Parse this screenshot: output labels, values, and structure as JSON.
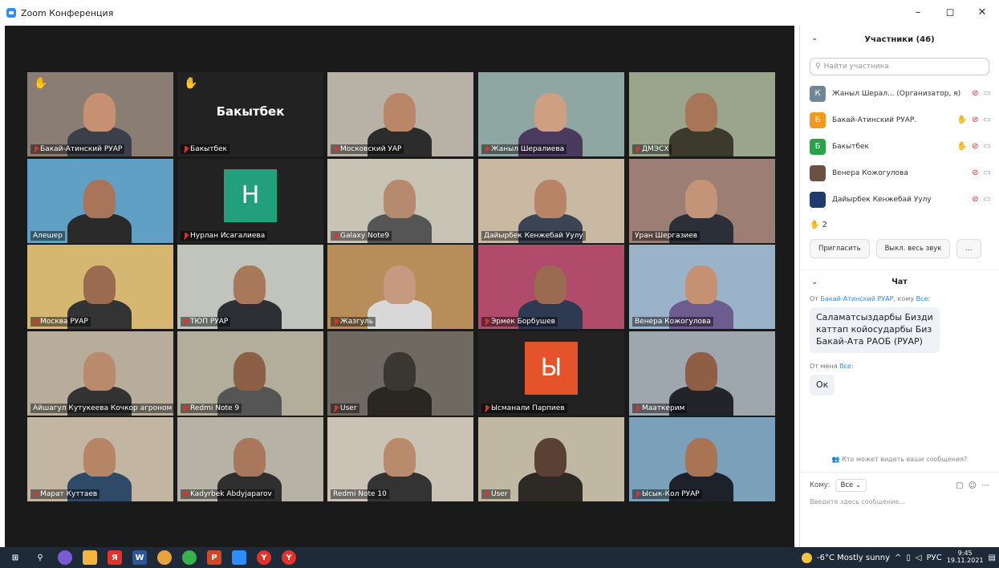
{
  "window": {
    "title": "Zoom Конференция",
    "min": "–",
    "max": "◻",
    "close": "✕"
  },
  "tiles": [
    {
      "name": "Бакай-Атинский РУАР",
      "hand": true,
      "muted": true,
      "kind": "video",
      "bg": "#8a7d74",
      "skin": "#c69072",
      "shirt": "#3b3f4a"
    },
    {
      "name": "Бакытбек",
      "hand": true,
      "muted": true,
      "kind": "text",
      "big": "Бакытбек"
    },
    {
      "name": "Московский УАР",
      "muted": true,
      "kind": "video",
      "bg": "#b8b1a6",
      "skin": "#b98768",
      "shirt": "#2c2c2c"
    },
    {
      "name": "Жаныл Шералиева",
      "muted": true,
      "kind": "video",
      "bg": "#8fa7a3",
      "skin": "#cf9f82",
      "shirt": "#4a3a5e"
    },
    {
      "name": "ДМЭСХ",
      "muted": true,
      "kind": "video",
      "bg": "#9aa58b",
      "skin": "#a87558",
      "shirt": "#3c3a2d"
    },
    {
      "name": "Алешер",
      "kind": "video",
      "bg": "#5fa0c4",
      "skin": "#a8745a",
      "shirt": "#2a2a2a"
    },
    {
      "name": "Нурлан Исагалиева",
      "muted": true,
      "kind": "avatar",
      "letter": "Н",
      "color": "#21a07b"
    },
    {
      "name": "Galaxy Note9",
      "muted": true,
      "kind": "video",
      "bg": "#c7c3b5",
      "skin": "#b58a6e",
      "shirt": "#555"
    },
    {
      "name": "Дайырбек Кенжебай Уулу",
      "kind": "video",
      "active": true,
      "bg": "#c9b9a2",
      "skin": "#b78565",
      "shirt": "#3c4454"
    },
    {
      "name": "Уран Шергазиев",
      "kind": "video",
      "bg": "#9c7e74",
      "skin": "#c49479",
      "shirt": "#2b2f38"
    },
    {
      "name": "Москва РУАР",
      "muted": true,
      "kind": "video",
      "bg": "#d6b771",
      "skin": "#9a6b51",
      "shirt": "#333"
    },
    {
      "name": "ТЮП РУАР",
      "muted": true,
      "kind": "video",
      "bg": "#c0c4bc",
      "skin": "#a9785a",
      "shirt": "#2c2f33"
    },
    {
      "name": "Жазгуль",
      "muted": true,
      "kind": "video",
      "bg": "#b78d5a",
      "skin": "#c59a80",
      "shirt": "#d8d8d8"
    },
    {
      "name": "Эрмек Борбушев",
      "muted": true,
      "kind": "video",
      "bg": "#b04b6b",
      "skin": "#9a6b51",
      "shirt": "#2e3a52"
    },
    {
      "name": "Венера Кожогулова",
      "kind": "video",
      "bg": "#9bb3c9",
      "skin": "#c69172",
      "shirt": "#6d5d8f"
    },
    {
      "name": "Айшагул Кутукеева  Кочкор агроном",
      "kind": "video",
      "bg": "#b8ad9b",
      "skin": "#b98a6c",
      "shirt": "#333"
    },
    {
      "name": "Redmi Note 9",
      "muted": true,
      "kind": "video",
      "bg": "#b3ae9c",
      "skin": "#8c5f47",
      "shirt": "#555"
    },
    {
      "name": "User",
      "muted": true,
      "kind": "video",
      "bg": "#6f6a61",
      "skin": "#3a3631",
      "shirt": "#2a2622"
    },
    {
      "name": "Ысманали Парпиев",
      "muted": true,
      "kind": "avatar",
      "letter": "Ы",
      "color": "#e5532b"
    },
    {
      "name": "Мааткерим",
      "muted": true,
      "kind": "video",
      "bg": "#9ea7ad",
      "skin": "#8e5e45",
      "shirt": "#22242a"
    },
    {
      "name": "Марат Куттаев",
      "muted": true,
      "kind": "video",
      "bg": "#c2b6a2",
      "skin": "#b58565",
      "shirt": "#2f4a68"
    },
    {
      "name": "Kadyrbek Abdyjaparov",
      "muted": true,
      "kind": "video",
      "bg": "#b7b2a6",
      "skin": "#a8775c",
      "shirt": "#2f2f2f"
    },
    {
      "name": "Redmi Note 10",
      "kind": "video",
      "bg": "#c9c2b5",
      "skin": "#b98b6d",
      "shirt": "#333"
    },
    {
      "name": "User",
      "muted": true,
      "kind": "video",
      "bg": "#c1b8a4",
      "skin": "#5a4133",
      "shirt": "#2d2a26"
    },
    {
      "name": "Ысык-Кол РУАР",
      "muted": true,
      "kind": "video",
      "bg": "#7ba0b9",
      "skin": "#a87454",
      "shirt": "#1d222a"
    }
  ],
  "participants": {
    "header": "Участники (46)",
    "search_placeholder": "Найти участника",
    "list": [
      {
        "letter": "К",
        "color": "#6f8796",
        "name": "Жаныл Шерал...  (Организатор, я)",
        "hand": false
      },
      {
        "letter": "Б",
        "color": "#f29a1f",
        "name": "Бакай-Атинский РУАР.",
        "hand": true
      },
      {
        "letter": "Б",
        "color": "#27a44a",
        "name": "Бакытбек",
        "hand": true
      },
      {
        "letter": "",
        "color": "#6b5043",
        "name": "Венера Кожогулова",
        "hand": false
      },
      {
        "letter": "",
        "color": "#1d3b6e",
        "name": "Дайырбек Кенжебай Уулу",
        "hand": false
      }
    ],
    "hands_count": "2",
    "invite_label": "Пригласить",
    "mute_all_label": "Выкл. весь звук",
    "more_label": "..."
  },
  "chat": {
    "header": "Чат",
    "msg1_from": "От",
    "msg1_sender": "Бакай-Атинский РУАР",
    "msg1_to_word": ", кому",
    "msg1_recipient": "Все",
    "msg1_text_1": "Саламатсыздарбы Бизди",
    "msg1_text_2": "каттап койосударбы Биз",
    "msg1_text_3": "Бакай-Ата РАОБ (РУАР)",
    "msg2_from": "От меня",
    "msg2_recipient": "Все",
    "msg2_text": "Ок",
    "who_can_see": "Кто может видеть ваши сообщения?",
    "to_label": "Кому:",
    "to_value": "Все",
    "input_placeholder": "Введите здесь сообщение..."
  },
  "taskbar": {
    "weather": "-6°C  Mostly sunny",
    "lang": "РУС",
    "time": "9:45",
    "date": "19.11.2021"
  }
}
